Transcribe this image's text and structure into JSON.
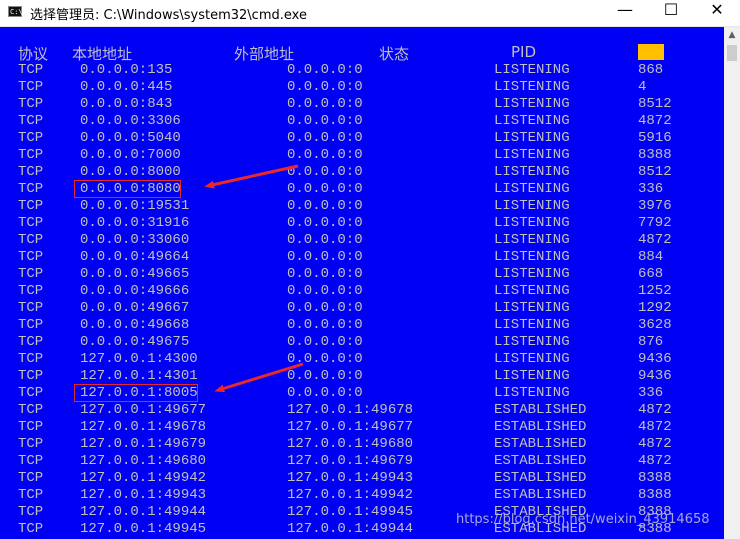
{
  "window": {
    "title": "选择管理员: C:\\Windows\\system32\\cmd.exe",
    "icon_text": "C:\\",
    "minimize_symbol": "—",
    "maximize_symbol": "☐",
    "close_symbol": "✕"
  },
  "headers": [
    "协议",
    "本地地址",
    "外部地址",
    "状态",
    "PID"
  ],
  "rows": [
    [
      "TCP",
      "0.0.0.0:135",
      "0.0.0.0:0",
      "LISTENING",
      "868"
    ],
    [
      "TCP",
      "0.0.0.0:445",
      "0.0.0.0:0",
      "LISTENING",
      "4"
    ],
    [
      "TCP",
      "0.0.0.0:843",
      "0.0.0.0:0",
      "LISTENING",
      "8512"
    ],
    [
      "TCP",
      "0.0.0.0:3306",
      "0.0.0.0:0",
      "LISTENING",
      "4872"
    ],
    [
      "TCP",
      "0.0.0.0:5040",
      "0.0.0.0:0",
      "LISTENING",
      "5916"
    ],
    [
      "TCP",
      "0.0.0.0:7000",
      "0.0.0.0:0",
      "LISTENING",
      "8388"
    ],
    [
      "TCP",
      "0.0.0.0:8000",
      "0.0.0.0:0",
      "LISTENING",
      "8512"
    ],
    [
      "TCP",
      "0.0.0.0:8080",
      "0.0.0.0:0",
      "LISTENING",
      "336"
    ],
    [
      "TCP",
      "0.0.0.0:19531",
      "0.0.0.0:0",
      "LISTENING",
      "3976"
    ],
    [
      "TCP",
      "0.0.0.0:31916",
      "0.0.0.0:0",
      "LISTENING",
      "7792"
    ],
    [
      "TCP",
      "0.0.0.0:33060",
      "0.0.0.0:0",
      "LISTENING",
      "4872"
    ],
    [
      "TCP",
      "0.0.0.0:49664",
      "0.0.0.0:0",
      "LISTENING",
      "884"
    ],
    [
      "TCP",
      "0.0.0.0:49665",
      "0.0.0.0:0",
      "LISTENING",
      "668"
    ],
    [
      "TCP",
      "0.0.0.0:49666",
      "0.0.0.0:0",
      "LISTENING",
      "1252"
    ],
    [
      "TCP",
      "0.0.0.0:49667",
      "0.0.0.0:0",
      "LISTENING",
      "1292"
    ],
    [
      "TCP",
      "0.0.0.0:49668",
      "0.0.0.0:0",
      "LISTENING",
      "3628"
    ],
    [
      "TCP",
      "0.0.0.0:49675",
      "0.0.0.0:0",
      "LISTENING",
      "876"
    ],
    [
      "TCP",
      "127.0.0.1:4300",
      "0.0.0.0:0",
      "LISTENING",
      "9436"
    ],
    [
      "TCP",
      "127.0.0.1:4301",
      "0.0.0.0:0",
      "LISTENING",
      "9436"
    ],
    [
      "TCP",
      "127.0.0.1:8005",
      "0.0.0.0:0",
      "LISTENING",
      "336"
    ],
    [
      "TCP",
      "127.0.0.1:49677",
      "127.0.0.1:49678",
      "ESTABLISHED",
      "4872"
    ],
    [
      "TCP",
      "127.0.0.1:49678",
      "127.0.0.1:49677",
      "ESTABLISHED",
      "4872"
    ],
    [
      "TCP",
      "127.0.0.1:49679",
      "127.0.0.1:49680",
      "ESTABLISHED",
      "4872"
    ],
    [
      "TCP",
      "127.0.0.1:49680",
      "127.0.0.1:49679",
      "ESTABLISHED",
      "4872"
    ],
    [
      "TCP",
      "127.0.0.1:49942",
      "127.0.0.1:49943",
      "ESTABLISHED",
      "8388"
    ],
    [
      "TCP",
      "127.0.0.1:49943",
      "127.0.0.1:49942",
      "ESTABLISHED",
      "8388"
    ],
    [
      "TCP",
      "127.0.0.1:49944",
      "127.0.0.1:49945",
      "ESTABLISHED",
      "8388"
    ],
    [
      "TCP",
      "127.0.0.1:49945",
      "127.0.0.1:49944",
      "ESTABLISHED",
      "8388"
    ]
  ],
  "highlighted_rows": [
    7,
    19
  ],
  "watermark": "https://blog.csdn.net/weixin_43914658",
  "colors": {
    "console_bg": "#0000f4",
    "text": "#c0c0c0",
    "annotation": "#e8282a",
    "cursor": "#ffc000"
  }
}
